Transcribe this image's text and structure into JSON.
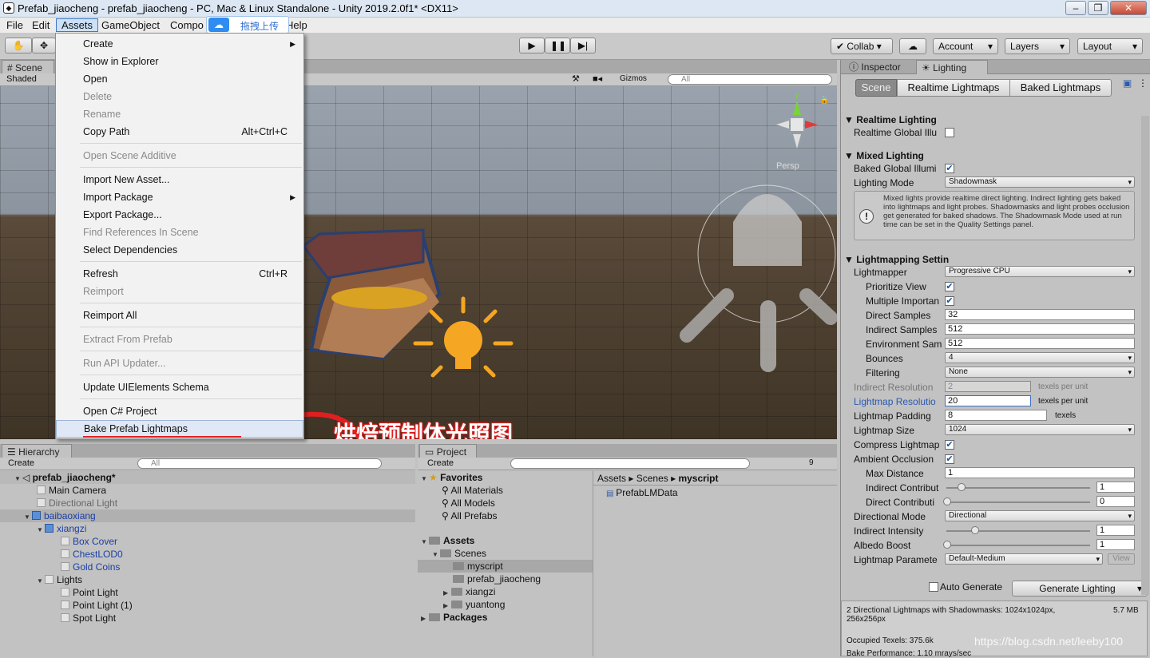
{
  "title": "Prefab_jiaocheng - prefab_jiaocheng - PC, Mac & Linux Standalone - Unity 2019.2.0f1* <DX11>",
  "menubar": [
    "File",
    "Edit",
    "Assets",
    "GameObject",
    "Compo",
    "Help"
  ],
  "upload_badge": "拖拽上传",
  "toolbar": {
    "collab": "Collab",
    "account": "Account",
    "layers": "Layers",
    "layout": "Layout"
  },
  "scene": {
    "tab": "Scene",
    "shaded": "Shaded",
    "gizmos": "Gizmos",
    "search": "All",
    "persp": "Persp"
  },
  "context_menu": [
    {
      "label": "Create",
      "arrow": true
    },
    {
      "label": "Show in Explorer"
    },
    {
      "label": "Open"
    },
    {
      "label": "Delete",
      "disabled": true
    },
    {
      "label": "Rename",
      "disabled": true
    },
    {
      "label": "Copy Path",
      "shortcut": "Alt+Ctrl+C"
    },
    {
      "label": "Open Scene Additive",
      "disabled": true
    },
    {
      "label": "Import New Asset..."
    },
    {
      "label": "Import Package",
      "arrow": true
    },
    {
      "label": "Export Package..."
    },
    {
      "label": "Find References In Scene",
      "disabled": true
    },
    {
      "label": "Select Dependencies"
    },
    {
      "label": "Refresh",
      "shortcut": "Ctrl+R"
    },
    {
      "label": "Reimport",
      "disabled": true
    },
    {
      "label": "Reimport All"
    },
    {
      "label": "Extract From Prefab",
      "disabled": true
    },
    {
      "label": "Run API Updater...",
      "disabled": true
    },
    {
      "label": "Update UIElements Schema"
    },
    {
      "label": "Open C# Project"
    },
    {
      "label": "Bake Prefab Lightmaps",
      "highlight": true
    }
  ],
  "annotation": "烘焙预制体光照图",
  "hierarchy": {
    "tab": "Hierarchy",
    "create": "Create",
    "search": "All",
    "rows": [
      "prefab_jiaocheng*",
      "Main Camera",
      "Directional Light",
      "baibaoxiang",
      "xiangzi",
      "Box Cover",
      "ChestLOD0",
      "Gold Coins",
      "Lights",
      "Point Light",
      "Point Light (1)",
      "Spot Light"
    ]
  },
  "project": {
    "tab": "Project",
    "create": "Create",
    "count": "9",
    "favorites": "Favorites",
    "fav_items": [
      "All Materials",
      "All Models",
      "All Prefabs"
    ],
    "assets": "Assets",
    "scenes": "Scenes",
    "scene_items": [
      "myscript",
      "prefab_jiaocheng",
      "xiangzi",
      "yuantong"
    ],
    "packages": "Packages",
    "breadcrumb": [
      "Assets",
      "Scenes",
      "myscript"
    ],
    "file": "PrefabLMData"
  },
  "inspector": {
    "tab1": "Inspector",
    "tab2": "Lighting",
    "subtabs": [
      "Scene",
      "Realtime Lightmaps",
      "Baked Lightmaps"
    ],
    "realtime_lighting": "Realtime Lighting",
    "realtime_gi": "Realtime Global Illu",
    "mixed_lighting": "Mixed Lighting",
    "baked_gi": "Baked Global Illumi",
    "lighting_mode": "Lighting Mode",
    "lighting_mode_val": "Shadowmask",
    "info": "Mixed lights provide realtime direct lighting. Indirect lighting gets baked into lightmaps and light probes. Shadowmasks and light probes occlusion get generated for baked shadows. The Shadowmask Mode used at run time can be set in the Quality Settings panel.",
    "lightmapping": "Lightmapping Settin",
    "fields": [
      {
        "label": "Lightmapper",
        "val": "Progressive CPU",
        "type": "dd"
      },
      {
        "label": "Prioritize View",
        "type": "chk"
      },
      {
        "label": "Multiple Importan",
        "type": "chk"
      },
      {
        "label": "Direct Samples",
        "val": "32",
        "type": "field"
      },
      {
        "label": "Indirect Samples",
        "val": "512",
        "type": "field"
      },
      {
        "label": "Environment Sam",
        "val": "512",
        "type": "field"
      },
      {
        "label": "Bounces",
        "val": "4",
        "type": "dd"
      },
      {
        "label": "Filtering",
        "val": "None",
        "type": "dd"
      }
    ],
    "indirect_res": "Indirect Resolution",
    "indirect_res_val": "2",
    "texels": "texels per unit",
    "lightmap_res": "Lightmap Resolutio",
    "lightmap_res_val": "20",
    "padding": "Lightmap Padding",
    "padding_val": "8",
    "texels_short": "texels",
    "size": "Lightmap Size",
    "size_val": "1024",
    "compress": "Compress Lightmap",
    "ao": "Ambient Occlusion",
    "max_dist": "Max Distance",
    "max_dist_val": "1",
    "indirect_contrib": "Indirect Contribut",
    "indirect_contrib_val": "1",
    "direct_contrib": "Direct Contributi",
    "direct_contrib_val": "0",
    "dir_mode": "Directional Mode",
    "dir_mode_val": "Directional",
    "indirect_int": "Indirect Intensity",
    "indirect_int_val": "1",
    "albedo": "Albedo Boost",
    "albedo_val": "1",
    "params": "Lightmap Paramete",
    "params_val": "Default-Medium",
    "view": "View",
    "auto_gen": "Auto Generate",
    "generate": "Generate Lighting",
    "stats1": "2 Directional Lightmaps with Shadowmasks: 1024x1024px, 256x256px",
    "stats1_size": "5.7 MB",
    "stats2": "Occupied Texels: 375.6k",
    "stats3": "Bake Performance: 1.10 mrays/sec"
  },
  "watermark": "https://blog.csdn.net/leeby100"
}
